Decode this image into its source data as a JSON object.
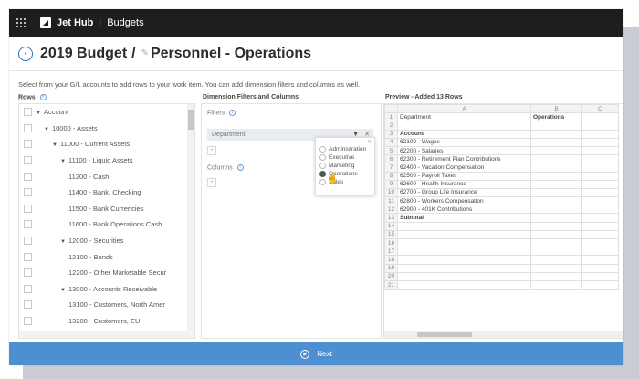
{
  "topbar": {
    "app_name": "Jet Hub",
    "section": "Budgets"
  },
  "title": {
    "main": "2019 Budget",
    "slash": "/",
    "sub": "Personnel - Operations"
  },
  "instructions": "Select from your G/L accounts to add rows to your work item. You can add dimension filters and columns as well.",
  "rows_panel": {
    "heading": "Rows",
    "items": [
      {
        "label": "Account",
        "expanded": true
      },
      {
        "label": "10000 - Assets",
        "expanded": true
      },
      {
        "label": "11000 - Current Assets",
        "expanded": true
      },
      {
        "label": "11100 - Liquid Assets",
        "expanded": true
      },
      {
        "label": "11200 - Cash"
      },
      {
        "label": "11400 - Bank, Checking"
      },
      {
        "label": "11500 - Bank Currencies"
      },
      {
        "label": "11600 - Bank Operations Cash"
      },
      {
        "label": "12000 - Securities",
        "expanded": true
      },
      {
        "label": "12100 - Bonds"
      },
      {
        "label": "12200 - Other Marketable Secur"
      },
      {
        "label": "13000 - Accounts Receivable",
        "expanded": true
      },
      {
        "label": "13100 - Customers, North Amer"
      },
      {
        "label": "13200 - Customers, EU"
      }
    ]
  },
  "filters_panel": {
    "heading": "Dimension Filters and Columns",
    "filters_label": "Filters",
    "filter_chip": "Department",
    "columns_label": "Columns",
    "add_symbol": "+"
  },
  "dropdown": {
    "options": [
      "Administration",
      "Executive",
      "Marketing",
      "Operations",
      "Sales"
    ],
    "selected": "Operations"
  },
  "preview": {
    "heading": "Preview - Added 13 Rows",
    "columns": [
      "A",
      "B",
      "C"
    ],
    "rows": [
      {
        "n": "1",
        "a": "Department",
        "b": "Operations",
        "bold_b": true
      },
      {
        "n": "2",
        "a": "",
        "b": ""
      },
      {
        "n": "3",
        "a": "Account",
        "b": "",
        "bold_a": true
      },
      {
        "n": "4",
        "a": "62100 - Wages",
        "b": ""
      },
      {
        "n": "5",
        "a": "62200 - Salaries",
        "b": ""
      },
      {
        "n": "6",
        "a": "62300 - Retirement Plan Contributions",
        "b": ""
      },
      {
        "n": "7",
        "a": "62400 - Vacation Compensation",
        "b": ""
      },
      {
        "n": "8",
        "a": "62500 - Payroll Taxes",
        "b": ""
      },
      {
        "n": "9",
        "a": "62600 - Health Insurance",
        "b": ""
      },
      {
        "n": "10",
        "a": "62700 - Group Life Insurance",
        "b": ""
      },
      {
        "n": "11",
        "a": "62800 - Workers Compensation",
        "b": ""
      },
      {
        "n": "12",
        "a": "62900 - 401K Contributions",
        "b": ""
      },
      {
        "n": "13",
        "a": "Subtotal",
        "b": "",
        "bold_a": true
      },
      {
        "n": "14",
        "a": "",
        "b": ""
      },
      {
        "n": "15",
        "a": "",
        "b": ""
      },
      {
        "n": "16",
        "a": "",
        "b": ""
      },
      {
        "n": "17",
        "a": "",
        "b": ""
      },
      {
        "n": "18",
        "a": "",
        "b": ""
      },
      {
        "n": "19",
        "a": "",
        "b": ""
      },
      {
        "n": "20",
        "a": "",
        "b": ""
      },
      {
        "n": "21",
        "a": "",
        "b": ""
      }
    ]
  },
  "footer": {
    "next_label": "Next"
  },
  "colors": {
    "accent": "#4d8fd1",
    "topbar": "#1e1e1e",
    "link": "#2a73c5"
  }
}
